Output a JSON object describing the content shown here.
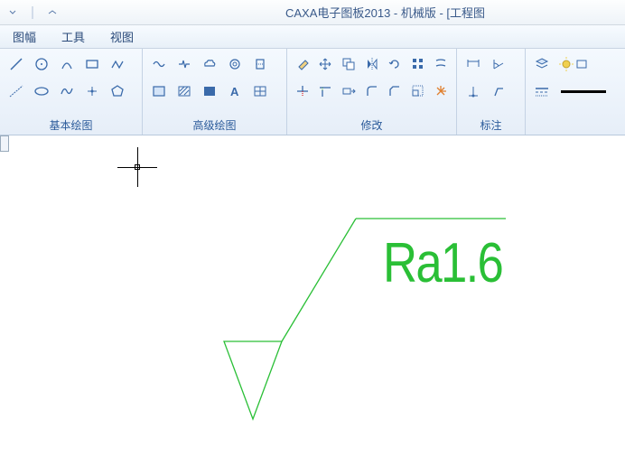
{
  "titlebar": {
    "title": "CAXA电子图板2013 - 机械版 - [工程图"
  },
  "menubar": {
    "items": [
      "图幅",
      "工具",
      "视图"
    ]
  },
  "ribbon": {
    "groups": [
      {
        "label": "基本绘图"
      },
      {
        "label": "高级绘图"
      },
      {
        "label": "修改"
      },
      {
        "label": "标注"
      }
    ]
  },
  "canvas": {
    "roughness_value": "Ra1.6",
    "symbol_color": "#2abf36"
  }
}
